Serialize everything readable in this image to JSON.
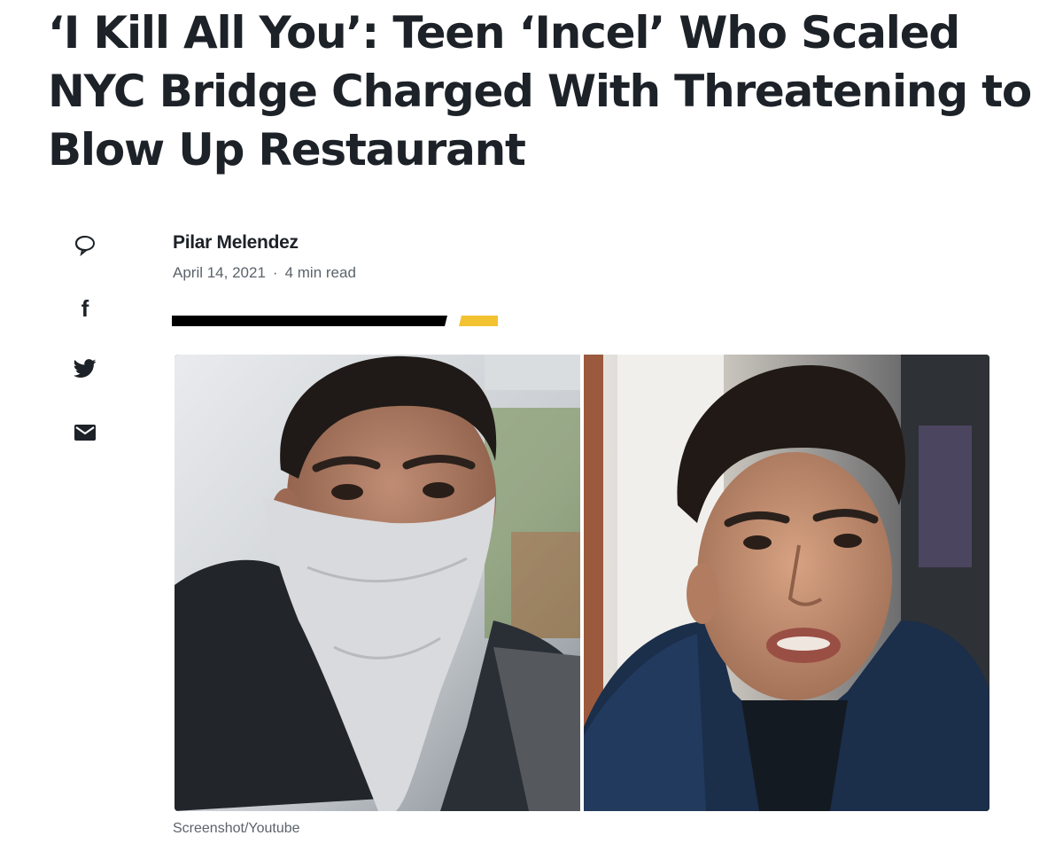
{
  "article": {
    "headline": "‘I Kill All You’: Teen ‘Incel’ Who Scaled NYC Bridge Charged With Threatening to Blow Up Restaurant",
    "author": "Pilar Melendez",
    "date": "April 14, 2021",
    "separator": "·",
    "read_time": "4 min read",
    "image_caption": "Screenshot/Youtube"
  },
  "share": {
    "icons": [
      "comment-icon",
      "facebook-icon",
      "twitter-icon",
      "email-icon"
    ],
    "facebook_glyph": "f"
  },
  "colors": {
    "headline": "#1d2228",
    "meta": "#5b636a",
    "rule_black": "#000000",
    "rule_accent": "#f2c230",
    "icon": "#1d2228"
  }
}
